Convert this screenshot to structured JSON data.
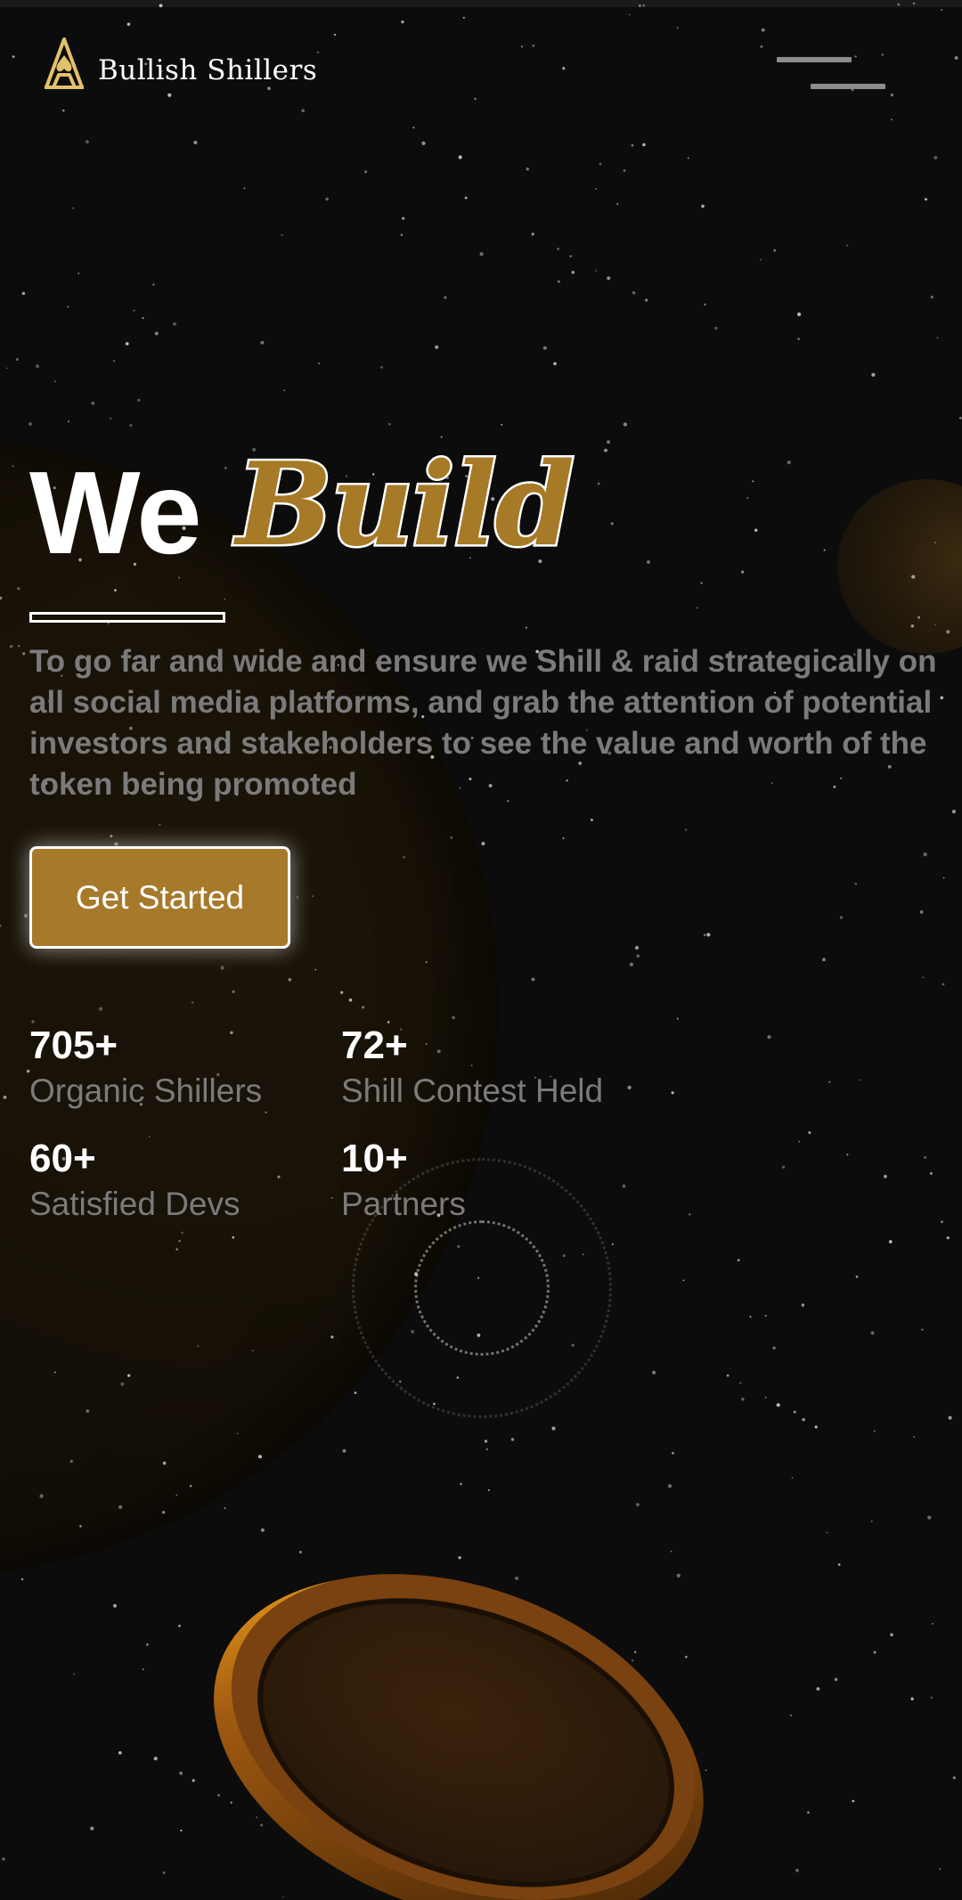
{
  "brand": {
    "name": "Bullish Shillers",
    "logo_icon": "spade-a-icon",
    "accent_color": "#a67a26"
  },
  "header": {
    "menu_icon": "hamburger-menu-icon"
  },
  "hero": {
    "title_plain": "We",
    "title_accent": "Build",
    "description": "To go far and wide and ensure we Shill & raid strategically on all social media platforms, and grab the attention of potential investors and stakeholders to see the value and worth of the token being promoted",
    "cta_label": "Get Started"
  },
  "stats": [
    {
      "value": "705+",
      "label": "Organic Shillers"
    },
    {
      "value": "72+",
      "label": "Shill Contest Held"
    },
    {
      "value": "60+",
      "label": "Satisfied Devs"
    },
    {
      "value": "10+",
      "label": "Partners"
    }
  ],
  "decor": {
    "background_color": "#0c0c0c",
    "coin_color": "#a05a10",
    "muted_text_color": "#7b7b7b"
  }
}
